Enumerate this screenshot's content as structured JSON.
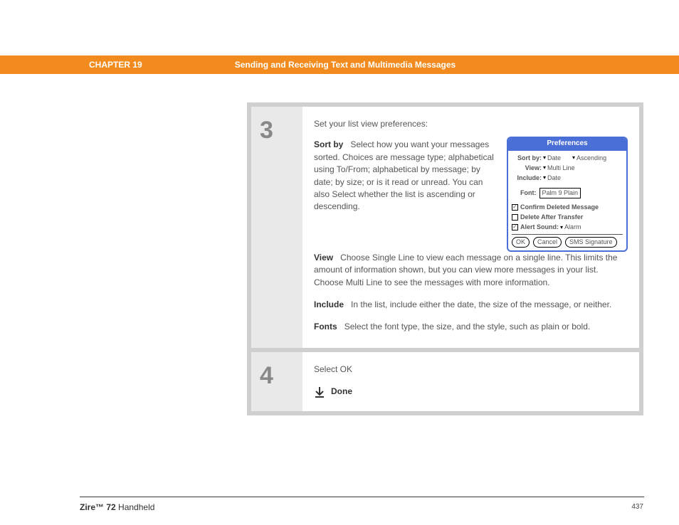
{
  "header": {
    "chapter": "CHAPTER 19",
    "title": "Sending and Receiving Text and Multimedia Messages"
  },
  "steps": {
    "s3": {
      "num": "3",
      "intro": "Set your list view preferences:",
      "sortby_label": "Sort by",
      "sortby_body": "Select how you want your messages sorted. Choices are message type; alphabetical using To/From; alphabetical by message; by date; by size; or is it read or unread. You can also Select whether the list is ascending or descending.",
      "view_label": "View",
      "view_body": "Choose Single Line to view each message on a single line. This limits the amount of information shown, but you can view more messages in your list. Choose Multi Line to see the messages with more information.",
      "include_label": "Include",
      "include_body": "In the list, include either the date, the size of the message, or neither.",
      "fonts_label": "Fonts",
      "fonts_body": "Select the font type, the size, and the style, such as plain or bold."
    },
    "s4": {
      "num": "4",
      "text": "Select OK",
      "done": "Done"
    }
  },
  "prefs": {
    "title": "Preferences",
    "sortby_label": "Sort by:",
    "sortby_value": "Date",
    "order_value": "Ascending",
    "view_label": "View:",
    "view_value": "Multi Line",
    "include_label": "Include:",
    "include_value": "Date",
    "font_label": "Font:",
    "font_value": "Palm 9 Plain",
    "confirm": "Confirm Deleted Message",
    "delete_after": "Delete After Transfer",
    "alert_label": "Alert Sound:",
    "alert_value": "Alarm",
    "ok": "OK",
    "cancel": "Cancel",
    "sms": "SMS Signature"
  },
  "footer": {
    "brand": "Zire™ 72",
    "product": "Handheld",
    "page": "437"
  }
}
